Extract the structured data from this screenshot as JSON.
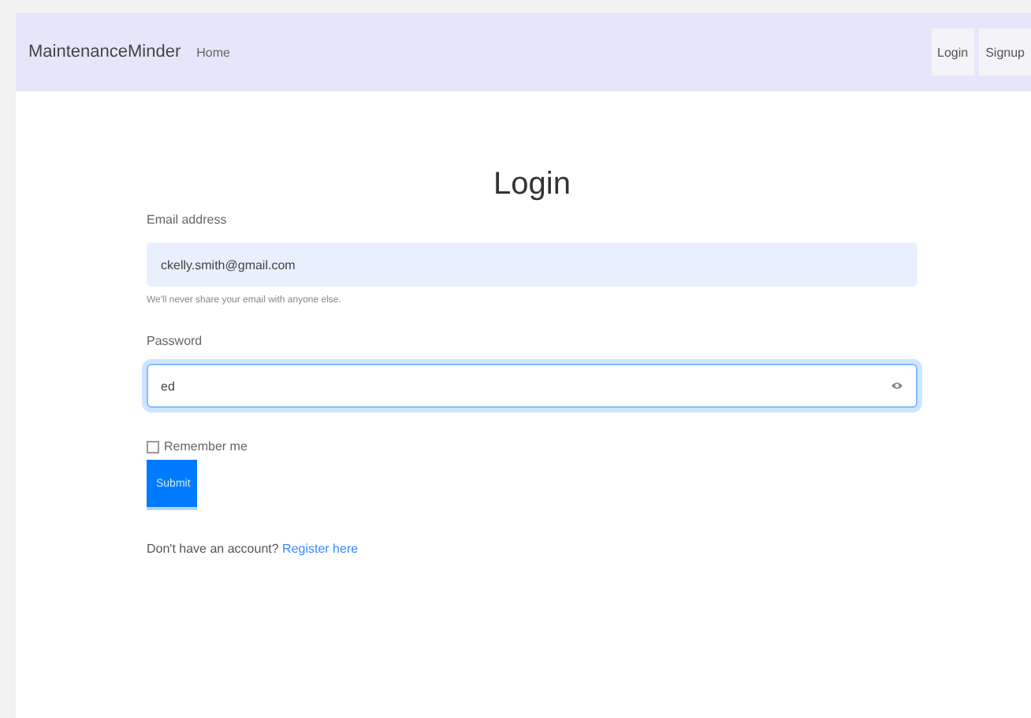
{
  "navbar": {
    "brand": "MaintenanceMinder",
    "links": [
      {
        "label": "Home"
      }
    ],
    "buttons": [
      {
        "label": "Login"
      },
      {
        "label": "Signup"
      }
    ]
  },
  "form": {
    "title": "Login",
    "email": {
      "label": "Email address",
      "value": "ckelly.smith@gmail.com",
      "help": "We'll never share your email with anyone else."
    },
    "password": {
      "label": "Password",
      "value": "ed",
      "focused": true
    },
    "remember": {
      "label": "Remember me",
      "checked": false
    },
    "submit": {
      "label": "Submit"
    },
    "footer": {
      "text": "Don't have an account?",
      "link": "Register here"
    }
  }
}
